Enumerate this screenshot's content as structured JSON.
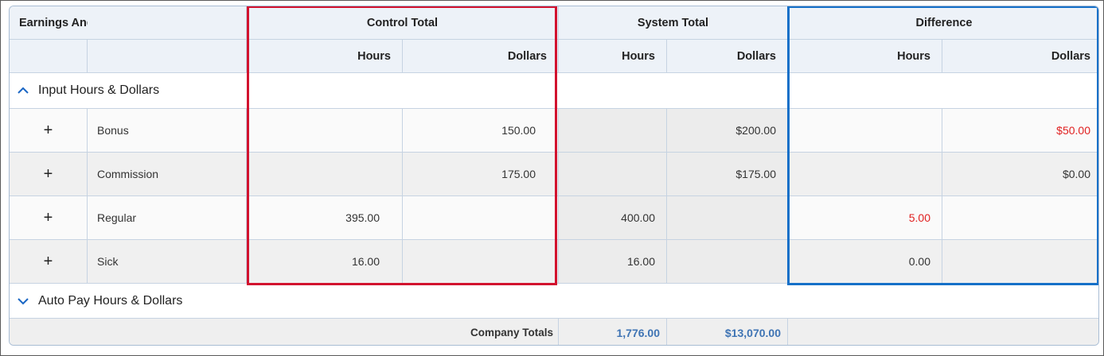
{
  "header": {
    "first_col": "Earnings And Memo Calcs",
    "control_total": "Control Total",
    "system_total": "System Total",
    "difference": "Difference",
    "hours": "Hours",
    "dollars": "Dollars"
  },
  "sections": [
    {
      "label": "Input Hours & Dollars",
      "expanded": true
    },
    {
      "label": "Auto Pay Hours & Dollars",
      "expanded": false
    }
  ],
  "rows": [
    {
      "name": "Bonus",
      "ctrl_hours": "",
      "ctrl_dollars": "150.00",
      "sys_hours": "",
      "sys_dollars": "$200.00",
      "diff_hours": "",
      "diff_dollars": "$50.00"
    },
    {
      "name": "Commission",
      "ctrl_hours": "",
      "ctrl_dollars": "175.00",
      "sys_hours": "",
      "sys_dollars": "$175.00",
      "diff_hours": "",
      "diff_dollars": "$0.00"
    },
    {
      "name": "Regular",
      "ctrl_hours": "395.00",
      "ctrl_dollars": "",
      "sys_hours": "400.00",
      "sys_dollars": "",
      "diff_hours": "5.00",
      "diff_dollars": ""
    },
    {
      "name": "Sick",
      "ctrl_hours": "16.00",
      "ctrl_dollars": "",
      "sys_hours": "16.00",
      "sys_dollars": "",
      "diff_hours": "0.00",
      "diff_dollars": ""
    }
  ],
  "expand_symbol": "+",
  "totals": {
    "label": "Company Totals",
    "hours": "1,776.00",
    "dollars": "$13,070.00"
  },
  "colors": {
    "negative_text": "#e02020",
    "total_value": "#3f74b4",
    "highlight_control": "#d2122e",
    "highlight_difference": "#1570c8"
  }
}
